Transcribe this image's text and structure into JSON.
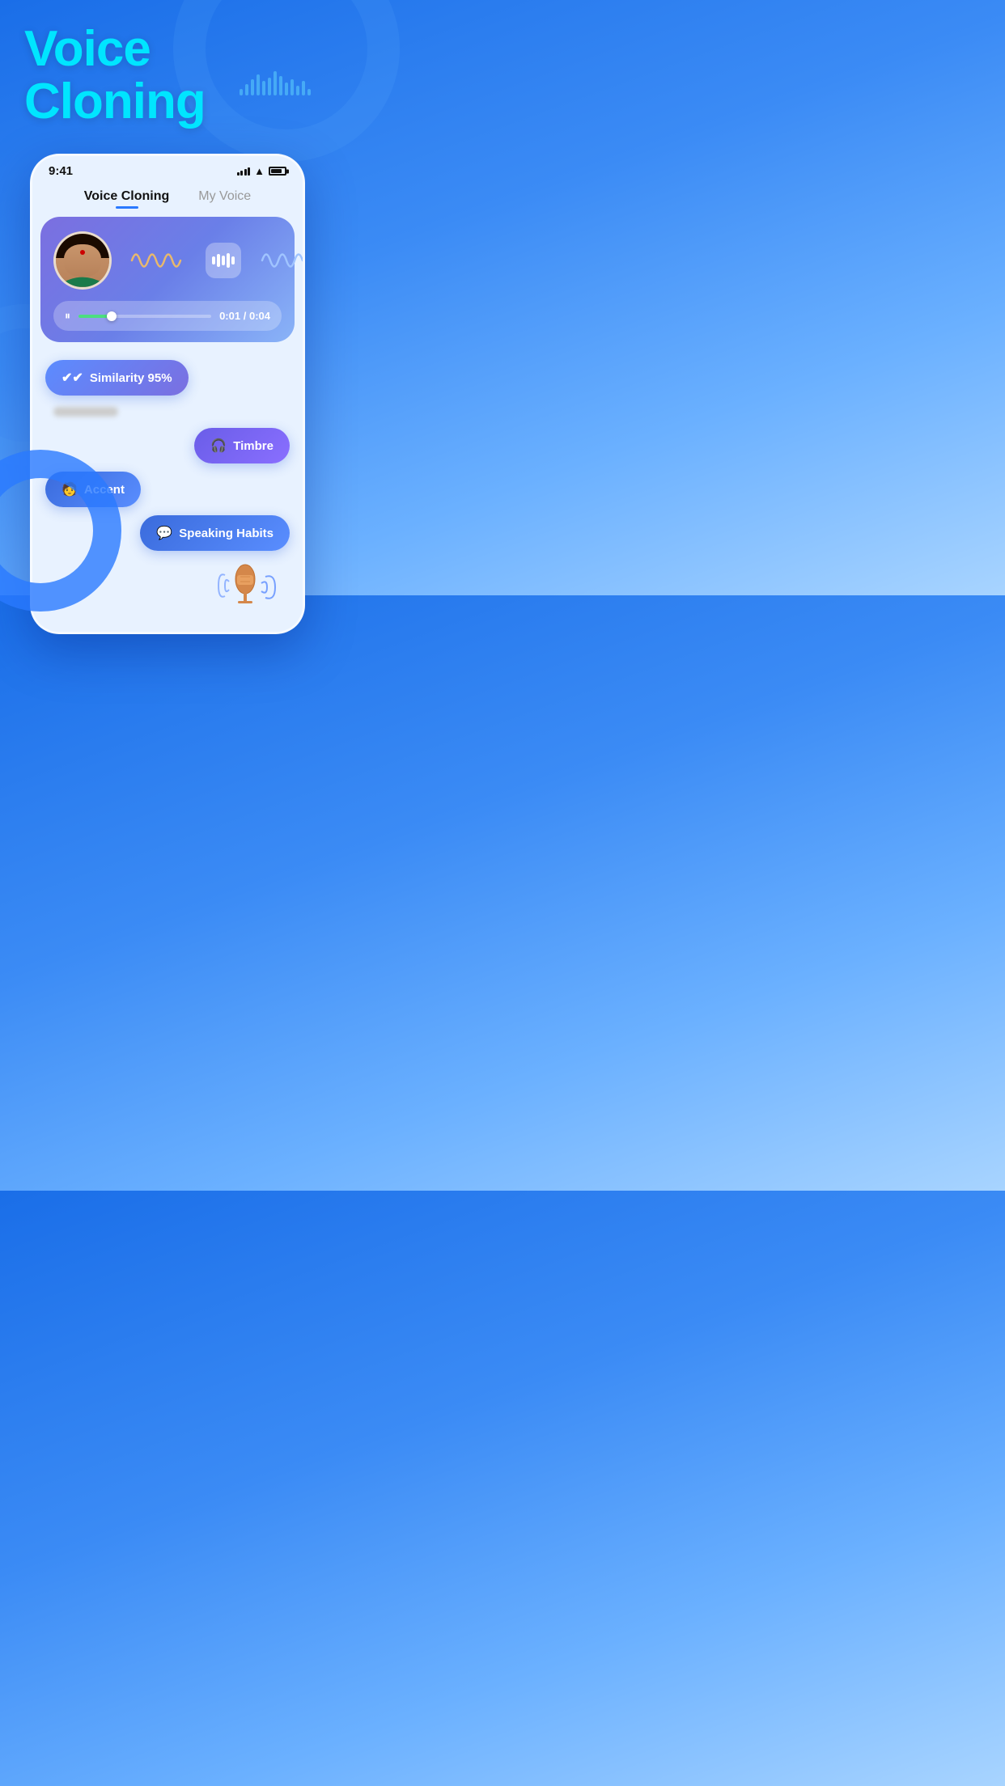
{
  "hero": {
    "title_line1": "Voice",
    "title_line2": "Cloning"
  },
  "phone": {
    "status_time": "9:41",
    "tabs": [
      {
        "label": "Voice Cloning",
        "active": true
      },
      {
        "label": "My Voice",
        "active": false
      }
    ],
    "player": {
      "pause_icon": "⏸",
      "current_time": "0:01",
      "total_time": "0:04",
      "progress_percent": 25
    },
    "features": [
      {
        "label": "Similarity 95%",
        "icon": "✔✔",
        "class": "chip-similarity",
        "align": "left"
      },
      {
        "label": "Timbre",
        "icon": "🎧",
        "class": "chip-timbre",
        "align": "right"
      },
      {
        "label": "Accent",
        "icon": "🧑",
        "class": "chip-accent",
        "align": "left"
      },
      {
        "label": "Speaking Habits",
        "icon": "💬",
        "class": "chip-speaking",
        "align": "right"
      }
    ]
  }
}
